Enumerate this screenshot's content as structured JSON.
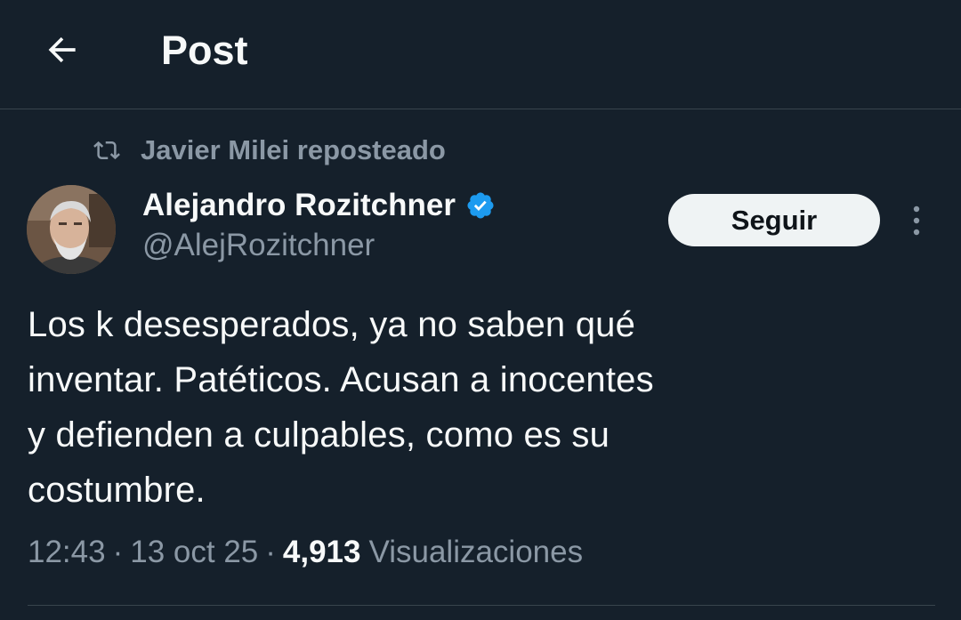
{
  "header": {
    "title": "Post",
    "back_icon": "arrow-left-icon"
  },
  "social_context": {
    "icon": "repost-icon",
    "text": "Javier Milei reposteado"
  },
  "author": {
    "name": "Alejandro Rozitchner",
    "handle": "@AlejRozitchner",
    "verified": true,
    "verified_color": "#1d9bf0",
    "avatar_icon": "user-avatar"
  },
  "follow_button": {
    "label": "Seguir"
  },
  "more_icon": "more-vertical-icon",
  "tweet": {
    "text": "Los k desesperados, ya no saben qué\ninventar. Patéticos. Acusan a inocentes\ny defienden a culpables, como es su\ncostumbre.",
    "time": "12:43",
    "separator": "·",
    "date": "13 oct 25",
    "views_count": "4,913",
    "views_label": "Visualizaciones"
  },
  "colors": {
    "background": "#15202b",
    "text_primary": "#f7f9f9",
    "text_secondary": "#8b98a5",
    "divider": "#38444d",
    "accent": "#1d9bf0"
  }
}
